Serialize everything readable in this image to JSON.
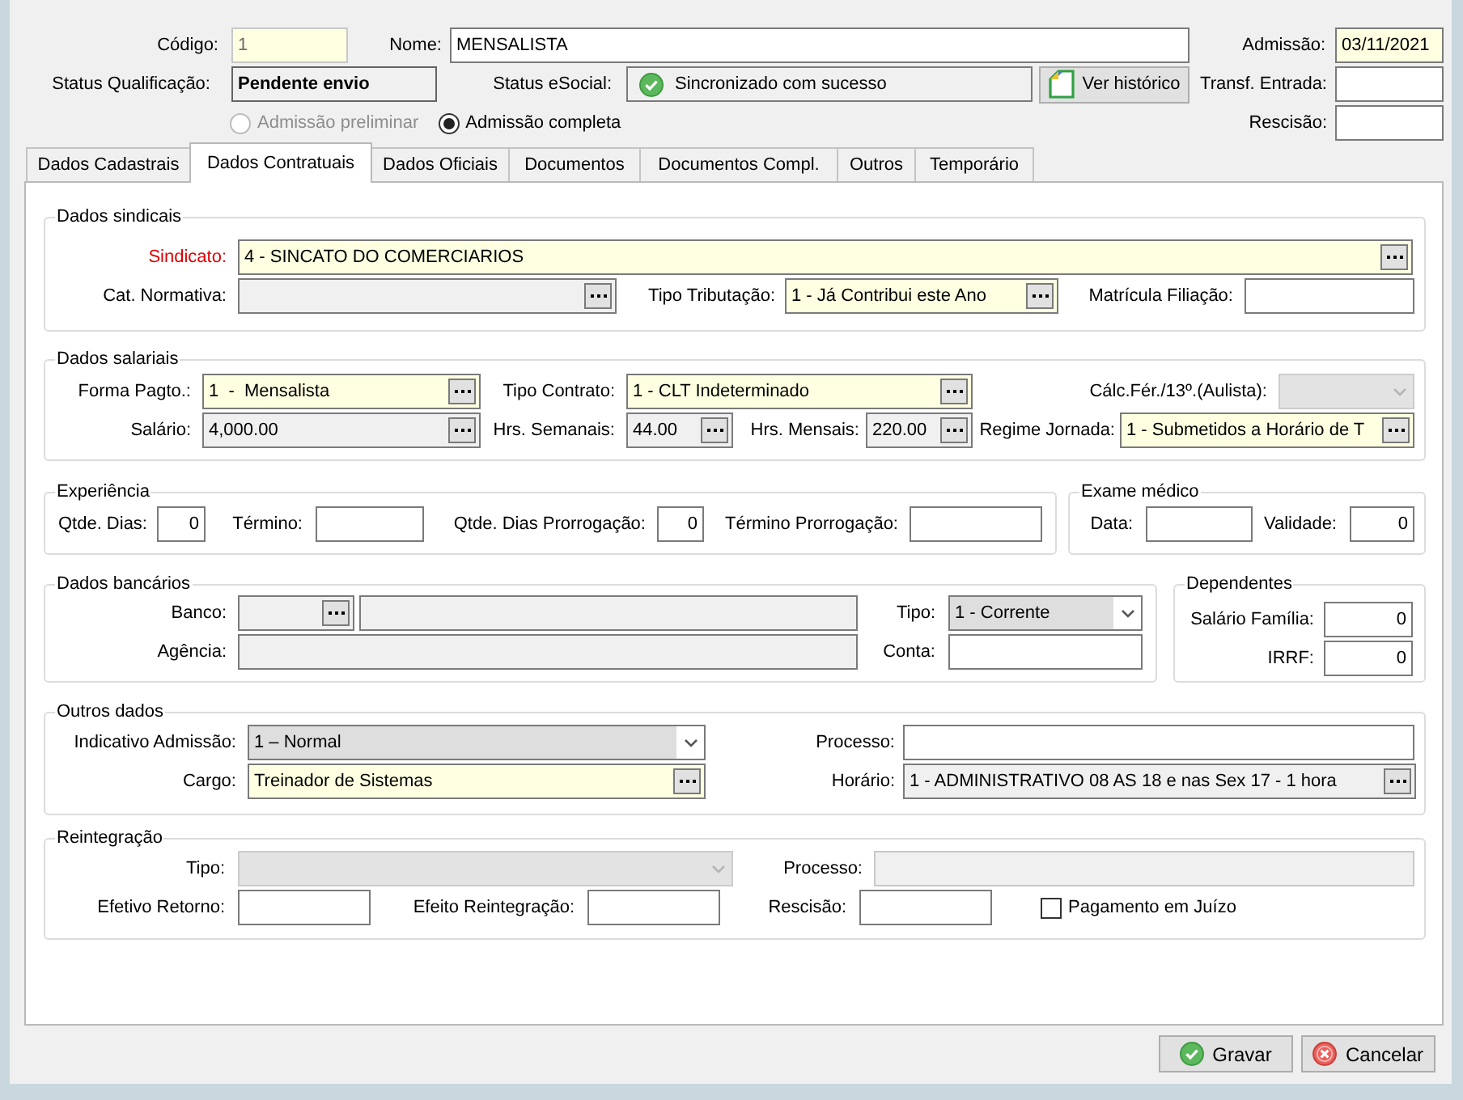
{
  "header": {
    "code": {
      "label": "Código:",
      "value": "1",
      "kind": "text",
      "required": true,
      "readonly": false,
      "disabled": true
    },
    "name": {
      "label": "Nome:",
      "value": "MENSALISTA",
      "kind": "text",
      "required": false,
      "readonly": false,
      "disabled": false
    },
    "admission_date": {
      "label": "Admissão:",
      "value": "03/11/2021",
      "kind": "text",
      "required": true,
      "readonly": false,
      "disabled": false
    },
    "qualification_status": {
      "label": "Status Qualificação:",
      "value": "Pendente envio"
    },
    "esocial_status": {
      "label": "Status eSocial:",
      "value": "Sincronizado com sucesso"
    },
    "history_button": {
      "label": "Ver histórico"
    },
    "transfer_date": {
      "label": "Transf. Entrada:",
      "kind": "text",
      "required": false,
      "readonly": false,
      "disabled": false
    },
    "termination_date": {
      "label": "Rescisão:",
      "kind": "text",
      "required": false,
      "readonly": false,
      "disabled": false
    },
    "admission_type": [
      {
        "label": "Admissão preliminar",
        "selected": false,
        "disabled": true
      },
      {
        "label": "Admissão completa",
        "selected": true,
        "disabled": false
      }
    ]
  },
  "tabs": [
    {
      "label": "Dados Cadastrais",
      "selected": false
    },
    {
      "label": "Dados Contratuais",
      "selected": true
    },
    {
      "label": "Dados Oficiais",
      "selected": false
    },
    {
      "label": "Documentos",
      "selected": false
    },
    {
      "label": "Documentos Compl.",
      "selected": false
    },
    {
      "label": "Outros",
      "selected": false
    },
    {
      "label": "Temporário",
      "selected": false
    }
  ],
  "groups": [
    {
      "title": "Dados sindicais",
      "rows": [
        [
          {
            "label": "Sindicato:",
            "label_alert": true,
            "value": "4 - SINCATO DO COMERCIARIOS",
            "kind": "lookup",
            "required": true,
            "readonly": false,
            "disabled": false
          }
        ],
        [
          {
            "label": "Cat. Normativa:",
            "label_alert": false,
            "kind": "lookup",
            "required": false,
            "readonly": true,
            "disabled": false
          },
          {
            "label": "Tipo Tributação:",
            "label_alert": false,
            "value": "1 - Já Contribui este Ano",
            "kind": "lookup",
            "required": true,
            "readonly": false,
            "disabled": false
          },
          {
            "label": "Matrícula Filiação:",
            "label_alert": false,
            "kind": "text",
            "required": false,
            "readonly": false,
            "disabled": false
          }
        ]
      ]
    },
    {
      "title": "Dados salariais",
      "rows": [
        [
          {
            "label": "Forma Pagto.:",
            "value": "1  -  Mensalista",
            "kind": "lookup",
            "required": true,
            "readonly": false,
            "disabled": false
          },
          {
            "label": "Tipo Contrato:",
            "value": "1 - CLT Indeterminado",
            "kind": "lookup",
            "required": true,
            "readonly": false,
            "disabled": false
          },
          "",
          {
            "label": "Cálc.Fér./13º.(Aulista):",
            "kind": "select",
            "disabled": true
          }
        ],
        [
          {
            "label": "Salário:",
            "value": "4,000.00",
            "kind": "lookup",
            "required": false,
            "readonly": true,
            "disabled": false
          },
          {
            "label": "Hrs. Semanais:",
            "value": "44.00",
            "kind": "lookup",
            "required": false,
            "readonly": true,
            "disabled": false
          },
          {
            "label": "Hrs. Mensais:",
            "value": "220.00",
            "kind": "lookup",
            "required": false,
            "readonly": true,
            "disabled": false
          },
          {
            "label": "Regime Jornada:",
            "value": "1 - Submetidos a Horário de T",
            "kind": "lookup",
            "required": true,
            "readonly": false,
            "disabled": false
          }
        ]
      ]
    },
    {
      "title": "Experiência",
      "rows": [
        [
          {
            "label": "Qtde. Dias:",
            "value": "0",
            "kind": "number",
            "required": false,
            "readonly": false,
            "disabled": false
          },
          {
            "label": "Término:",
            "kind": "text",
            "required": false,
            "readonly": false,
            "disabled": false
          },
          {
            "label": "Qtde. Dias Prorrogação:",
            "value": "0",
            "kind": "number",
            "required": false,
            "readonly": false,
            "disabled": false
          },
          {
            "label": "Término Prorrogação:",
            "kind": "text",
            "required": false,
            "readonly": false,
            "disabled": false
          }
        ]
      ]
    },
    {
      "title": "Exame médico",
      "rows": [
        [
          {
            "label": "Data:",
            "kind": "text",
            "required": false,
            "readonly": false,
            "disabled": false
          },
          {
            "label": "Validade:",
            "value": "0",
            "kind": "number",
            "required": false,
            "readonly": false,
            "disabled": false
          }
        ]
      ]
    },
    {
      "title": "Dados bancários",
      "rows": [
        [
          {
            "label": "Banco:",
            "kind": "lookup",
            "required": false,
            "readonly": true,
            "disabled": false
          },
          {
            "kind": "text",
            "required": false,
            "readonly": true,
            "disabled": false
          },
          {
            "label": "Tipo:",
            "value": "1 - Corrente",
            "kind": "select",
            "disabled": false
          }
        ],
        [
          {
            "label": "Agência:",
            "kind": "text",
            "required": false,
            "readonly": true,
            "disabled": false
          },
          "",
          {
            "label": "Conta:",
            "kind": "text",
            "required": false,
            "readonly": false,
            "disabled": false
          }
        ]
      ]
    },
    {
      "title": "Dependentes",
      "rows": [
        [
          {
            "label": "Salário Família:",
            "value": "0",
            "kind": "number",
            "required": false,
            "readonly": false,
            "disabled": false
          }
        ],
        [
          {
            "label": "IRRF:",
            "value": "0",
            "kind": "number",
            "required": false,
            "readonly": false,
            "disabled": false
          }
        ]
      ]
    },
    {
      "title": "Outros dados",
      "rows": [
        [
          {
            "label": "Indicativo Admissão:",
            "value": "1 – Normal",
            "kind": "select",
            "disabled": false
          },
          {
            "label": "Processo:",
            "kind": "text",
            "required": false,
            "readonly": false,
            "disabled": false
          }
        ],
        [
          {
            "label": "Cargo:",
            "value": "Treinador de Sistemas",
            "kind": "lookup",
            "required": true,
            "readonly": false,
            "disabled": false
          },
          {
            "label": "Horário:",
            "value": "1 - ADMINISTRATIVO 08 AS 18 e nas Sex 17 - 1 hora",
            "kind": "lookup",
            "required": false,
            "readonly": true,
            "disabled": false
          }
        ]
      ]
    },
    {
      "title": "Reintegração",
      "rows": [
        [
          {
            "label": "Tipo:",
            "kind": "select",
            "disabled": true
          },
          "",
          {
            "label": "Processo:",
            "kind": "text",
            "required": false,
            "readonly": true,
            "disabled": true
          }
        ],
        [
          {
            "label": "Efetivo Retorno:",
            "kind": "text",
            "required": false,
            "readonly": false,
            "disabled": false
          },
          {
            "label": "Efeito Reintegração:",
            "kind": "text",
            "required": false,
            "readonly": false,
            "disabled": false
          },
          {
            "label": "Rescisão:",
            "kind": "text",
            "required": false,
            "readonly": false,
            "disabled": false
          },
          {
            "label": "Pagamento em Juízo",
            "kind": "checkbox",
            "checked": false
          }
        ]
      ]
    }
  ],
  "buttons": [
    {
      "label": "Gravar",
      "kind": "confirm"
    },
    {
      "label": "Cancelar",
      "kind": "cancel"
    }
  ]
}
